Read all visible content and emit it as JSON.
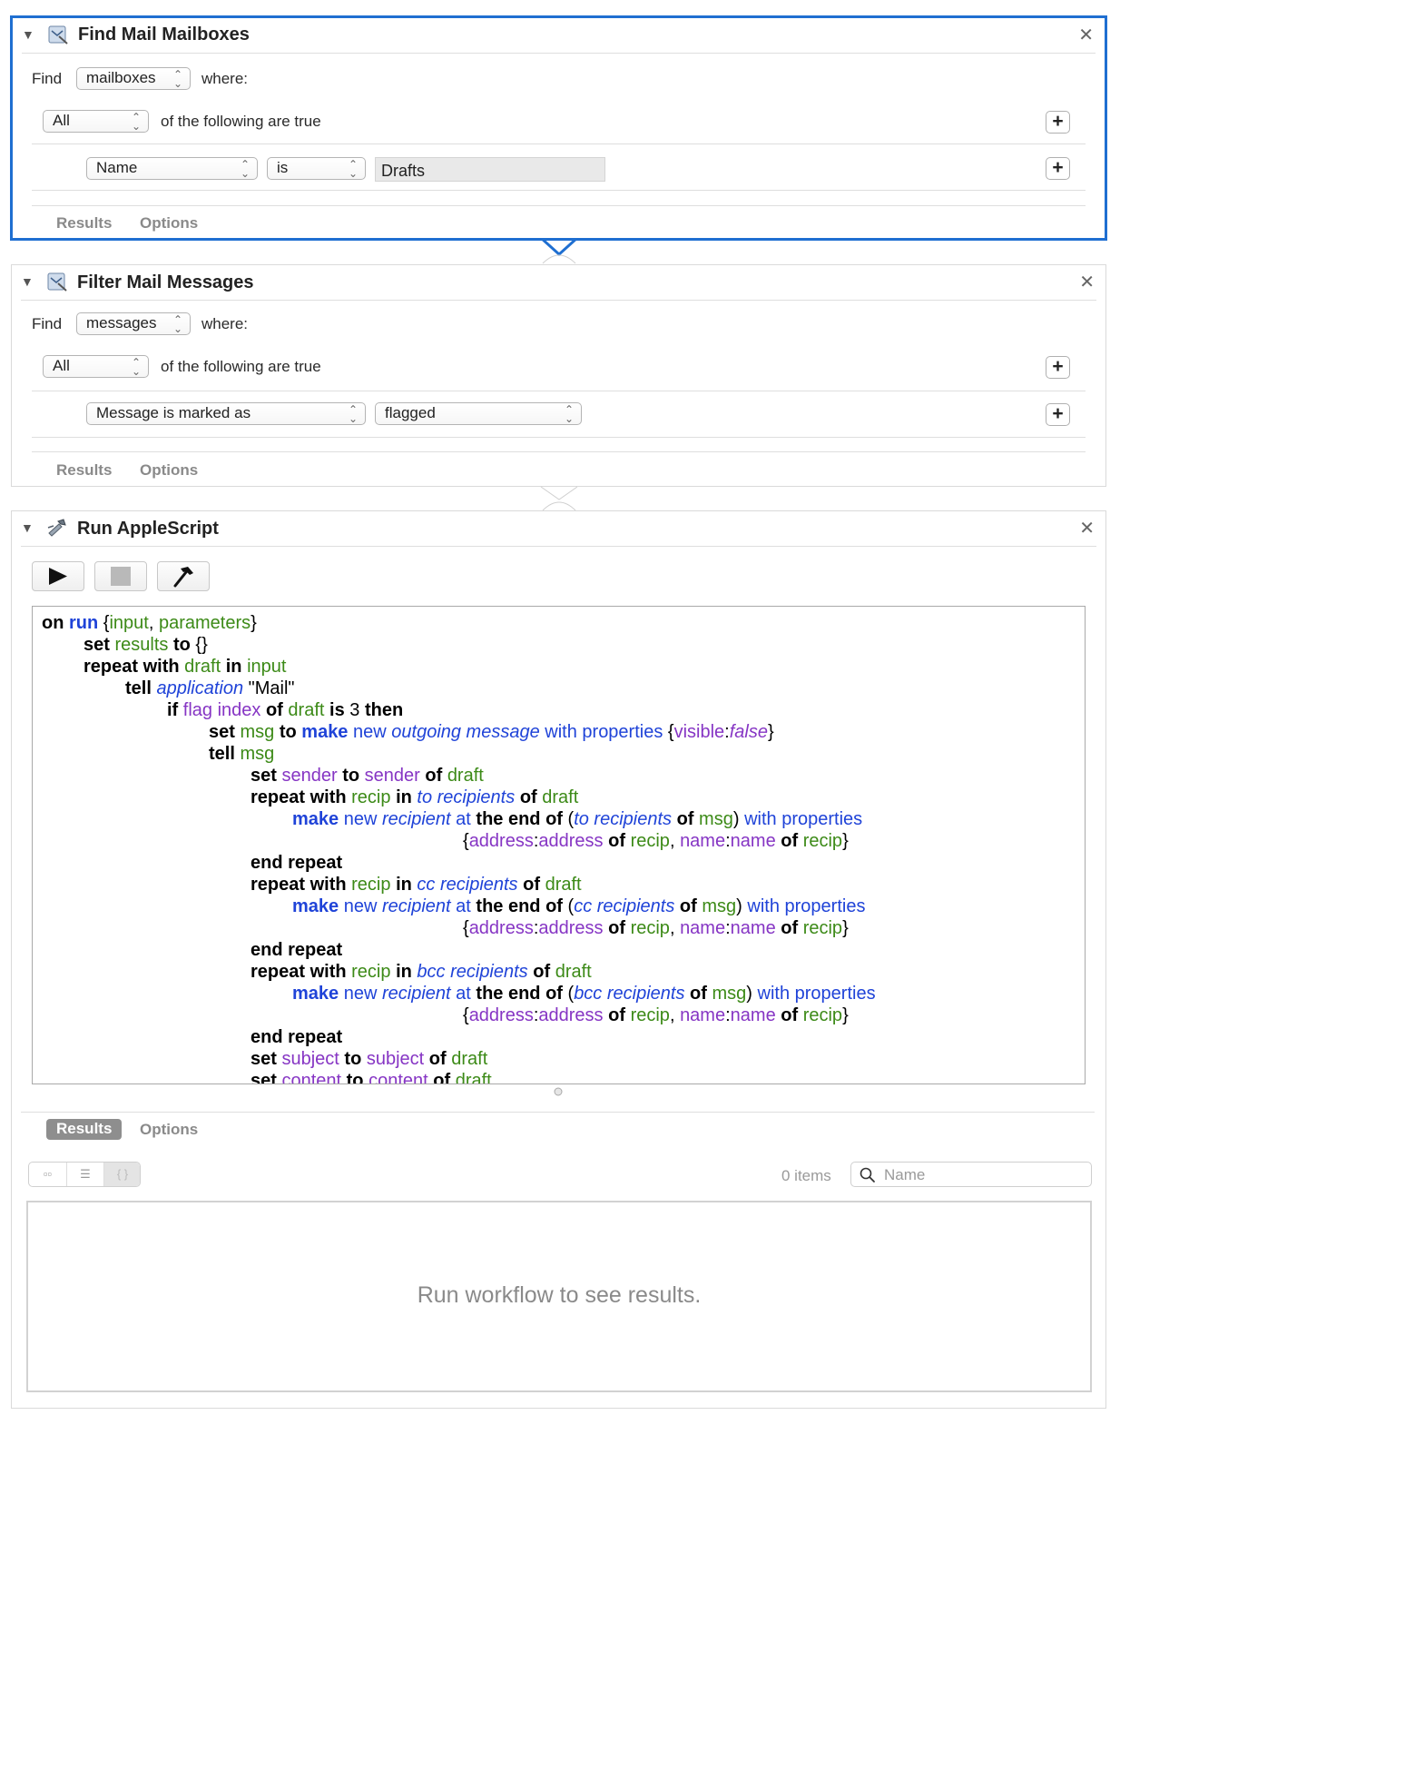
{
  "find_mailboxes": {
    "title": "Find Mail Mailboxes",
    "find_label": "Find",
    "find_popup": "mailboxes",
    "where_label": "where:",
    "match_popup": "All",
    "match_text": "of the following are true",
    "criteria_field_popup": "Name",
    "criteria_operator_popup": "is",
    "criteria_value": "Drafts",
    "tabs": [
      "Results",
      "Options"
    ]
  },
  "filter_messages": {
    "title": "Filter Mail Messages",
    "find_label": "Find",
    "find_popup": "messages",
    "where_label": "where:",
    "match_popup": "All",
    "match_text": "of the following are true",
    "criteria_field_popup": "Message is marked as",
    "criteria_value_popup": "flagged",
    "tabs": [
      "Results",
      "Options"
    ]
  },
  "run_applescript": {
    "title": "Run AppleScript",
    "tabs": [
      "Results",
      "Options"
    ],
    "items_count": "0 items",
    "search_placeholder": "Name",
    "empty_message": "Run workflow to see results.",
    "code_lines": [
      "on run {input, parameters}",
      "set results to {}",
      "repeat with draft in input",
      "tell application \"Mail\"",
      "if flag index of draft is 3 then",
      "set msg to make new outgoing message with properties {visible:false}",
      "tell msg",
      "set sender to sender of draft",
      "repeat with recip in to recipients of draft",
      "make new recipient at the end of (to recipients of msg) with properties",
      "{address:address of recip, name:name of recip}",
      "end repeat",
      "repeat with recip in cc recipients of draft",
      "make new recipient at the end of (cc recipients of msg) with properties",
      "{address:address of recip, name:name of recip}",
      "end repeat",
      "repeat with recip in bcc recipients of draft",
      "make new recipient at the end of (bcc recipients of msg) with properties",
      "{address:address of recip, name:name of recip}",
      "end repeat",
      "set subject to subject of draft",
      "set content to content of draft"
    ]
  },
  "icons": {
    "disclosure": "disclosure-triangle-icon",
    "mail_app": "mail-app-icon",
    "script_app": "script-editor-icon",
    "close": "close-icon",
    "add": "plus-icon",
    "run": "play-icon",
    "stop": "stop-icon",
    "compile": "hammer-icon",
    "search": "magnifier-icon"
  },
  "colors": {
    "selection_border": "#1f6fd1",
    "keyword": "#000000",
    "command": "#1f43d8",
    "variable": "#3c8a17",
    "property": "#8635c4"
  }
}
